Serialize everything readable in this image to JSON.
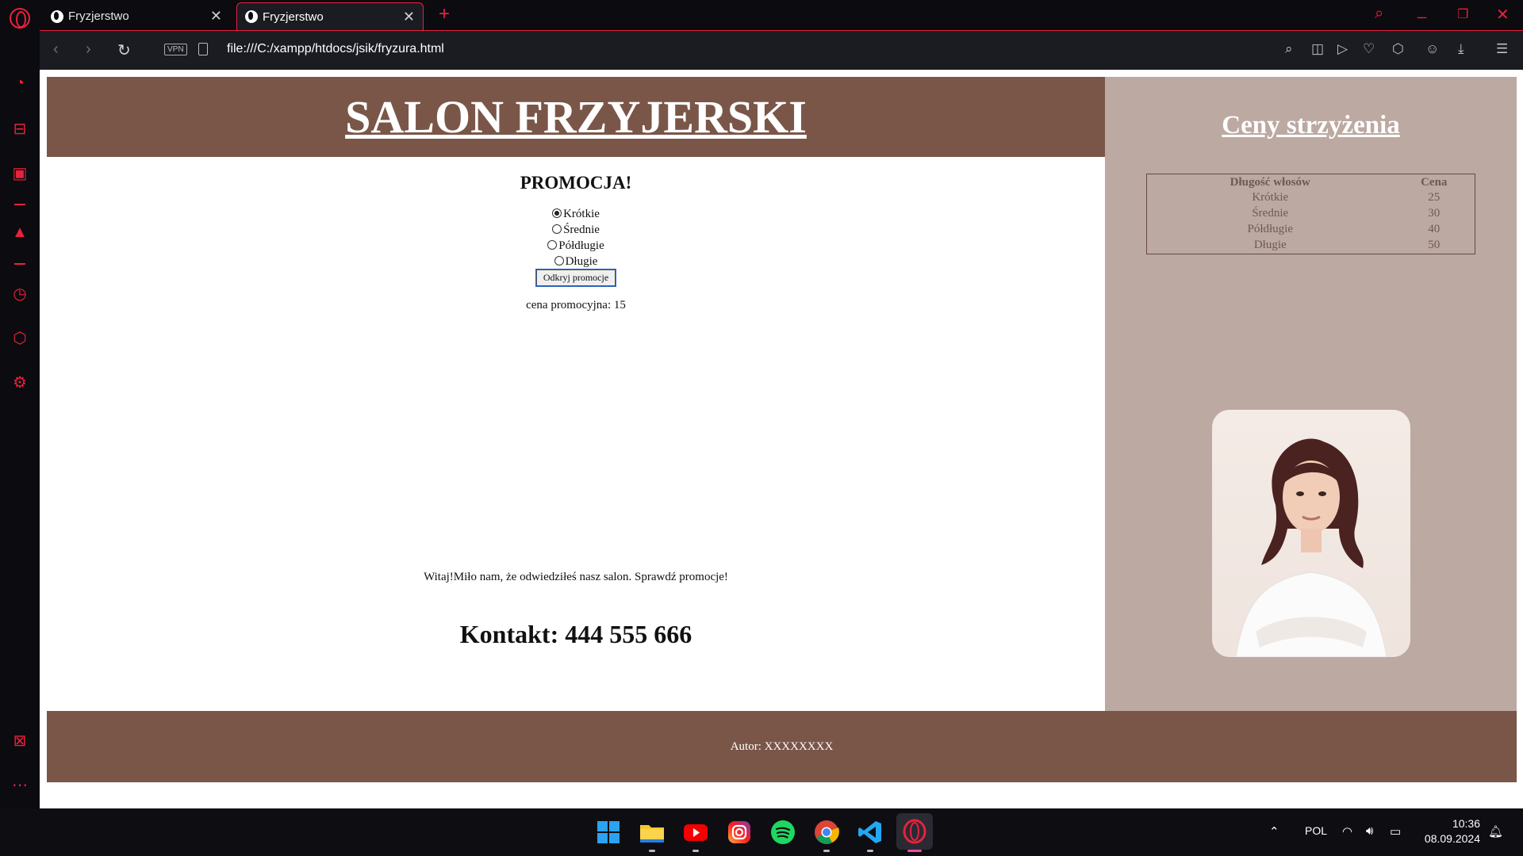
{
  "browser": {
    "tabs": [
      {
        "title": "Fryzjerstwo",
        "active": false
      },
      {
        "title": "Fryzjerstwo",
        "active": true
      }
    ],
    "url": "file:///C:/xampp/htdocs/jsik/fryzura.html",
    "vpn_label": "VPN",
    "accent_color": "#e8213d"
  },
  "page": {
    "banner_title": "SALON FRZYJERSKI",
    "promo_heading": "PROMOCJA!",
    "options": [
      {
        "label": "Krótkie",
        "checked": true
      },
      {
        "label": "Średnie",
        "checked": false
      },
      {
        "label": "Półdługie",
        "checked": false
      },
      {
        "label": "Długie",
        "checked": false
      }
    ],
    "promo_button": "Odkryj promocje",
    "promo_result": "cena promocyjna: 15",
    "welcome_text": "Witaj!Miło nam, że odwiedziłeś nasz salon. Sprawdź promocje!",
    "contact": "Kontakt: 444 555 666",
    "prices_heading": "Ceny strzyżenia",
    "price_table": {
      "headers": [
        "Długość włosów",
        "Cena"
      ],
      "rows": [
        [
          "Krótkie",
          "25"
        ],
        [
          "Średnie",
          "30"
        ],
        [
          "Półdługie",
          "40"
        ],
        [
          "Długie",
          "50"
        ]
      ]
    },
    "footer": "Autor: XXXXXXXX",
    "colors": {
      "banner": "#7a5649",
      "right_panel": "#bca9a1"
    }
  },
  "taskbar": {
    "apps": [
      "windows-start",
      "file-explorer",
      "youtube",
      "instagram",
      "spotify",
      "chrome",
      "vscode",
      "opera"
    ],
    "language": "POL",
    "time": "10:36",
    "date": "08.09.2024"
  }
}
